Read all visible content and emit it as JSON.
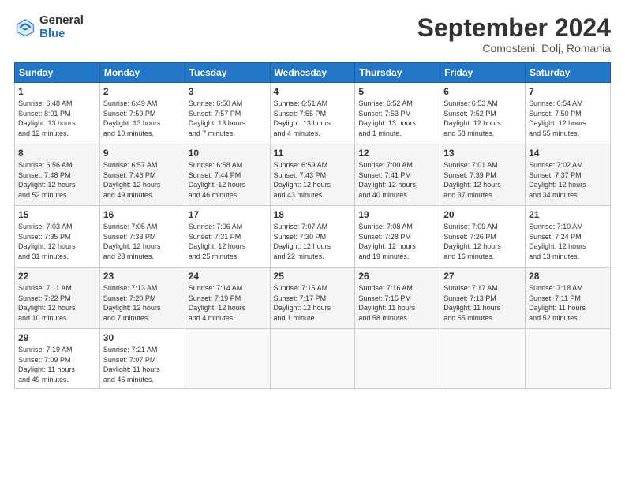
{
  "header": {
    "logo_general": "General",
    "logo_blue": "Blue",
    "month_title": "September 2024",
    "location": "Comosteni, Dolj, Romania"
  },
  "days_of_week": [
    "Sunday",
    "Monday",
    "Tuesday",
    "Wednesday",
    "Thursday",
    "Friday",
    "Saturday"
  ],
  "weeks": [
    [
      {
        "day": "1",
        "info": "Sunrise: 6:48 AM\nSunset: 8:01 PM\nDaylight: 13 hours\nand 12 minutes."
      },
      {
        "day": "2",
        "info": "Sunrise: 6:49 AM\nSunset: 7:59 PM\nDaylight: 13 hours\nand 10 minutes."
      },
      {
        "day": "3",
        "info": "Sunrise: 6:50 AM\nSunset: 7:57 PM\nDaylight: 13 hours\nand 7 minutes."
      },
      {
        "day": "4",
        "info": "Sunrise: 6:51 AM\nSunset: 7:55 PM\nDaylight: 13 hours\nand 4 minutes."
      },
      {
        "day": "5",
        "info": "Sunrise: 6:52 AM\nSunset: 7:53 PM\nDaylight: 13 hours\nand 1 minute."
      },
      {
        "day": "6",
        "info": "Sunrise: 6:53 AM\nSunset: 7:52 PM\nDaylight: 12 hours\nand 58 minutes."
      },
      {
        "day": "7",
        "info": "Sunrise: 6:54 AM\nSunset: 7:50 PM\nDaylight: 12 hours\nand 55 minutes."
      }
    ],
    [
      {
        "day": "8",
        "info": "Sunrise: 6:56 AM\nSunset: 7:48 PM\nDaylight: 12 hours\nand 52 minutes."
      },
      {
        "day": "9",
        "info": "Sunrise: 6:57 AM\nSunset: 7:46 PM\nDaylight: 12 hours\nand 49 minutes."
      },
      {
        "day": "10",
        "info": "Sunrise: 6:58 AM\nSunset: 7:44 PM\nDaylight: 12 hours\nand 46 minutes."
      },
      {
        "day": "11",
        "info": "Sunrise: 6:59 AM\nSunset: 7:43 PM\nDaylight: 12 hours\nand 43 minutes."
      },
      {
        "day": "12",
        "info": "Sunrise: 7:00 AM\nSunset: 7:41 PM\nDaylight: 12 hours\nand 40 minutes."
      },
      {
        "day": "13",
        "info": "Sunrise: 7:01 AM\nSunset: 7:39 PM\nDaylight: 12 hours\nand 37 minutes."
      },
      {
        "day": "14",
        "info": "Sunrise: 7:02 AM\nSunset: 7:37 PM\nDaylight: 12 hours\nand 34 minutes."
      }
    ],
    [
      {
        "day": "15",
        "info": "Sunrise: 7:03 AM\nSunset: 7:35 PM\nDaylight: 12 hours\nand 31 minutes."
      },
      {
        "day": "16",
        "info": "Sunrise: 7:05 AM\nSunset: 7:33 PM\nDaylight: 12 hours\nand 28 minutes."
      },
      {
        "day": "17",
        "info": "Sunrise: 7:06 AM\nSunset: 7:31 PM\nDaylight: 12 hours\nand 25 minutes."
      },
      {
        "day": "18",
        "info": "Sunrise: 7:07 AM\nSunset: 7:30 PM\nDaylight: 12 hours\nand 22 minutes."
      },
      {
        "day": "19",
        "info": "Sunrise: 7:08 AM\nSunset: 7:28 PM\nDaylight: 12 hours\nand 19 minutes."
      },
      {
        "day": "20",
        "info": "Sunrise: 7:09 AM\nSunset: 7:26 PM\nDaylight: 12 hours\nand 16 minutes."
      },
      {
        "day": "21",
        "info": "Sunrise: 7:10 AM\nSunset: 7:24 PM\nDaylight: 12 hours\nand 13 minutes."
      }
    ],
    [
      {
        "day": "22",
        "info": "Sunrise: 7:11 AM\nSunset: 7:22 PM\nDaylight: 12 hours\nand 10 minutes."
      },
      {
        "day": "23",
        "info": "Sunrise: 7:13 AM\nSunset: 7:20 PM\nDaylight: 12 hours\nand 7 minutes."
      },
      {
        "day": "24",
        "info": "Sunrise: 7:14 AM\nSunset: 7:19 PM\nDaylight: 12 hours\nand 4 minutes."
      },
      {
        "day": "25",
        "info": "Sunrise: 7:15 AM\nSunset: 7:17 PM\nDaylight: 12 hours\nand 1 minute."
      },
      {
        "day": "26",
        "info": "Sunrise: 7:16 AM\nSunset: 7:15 PM\nDaylight: 11 hours\nand 58 minutes."
      },
      {
        "day": "27",
        "info": "Sunrise: 7:17 AM\nSunset: 7:13 PM\nDaylight: 11 hours\nand 55 minutes."
      },
      {
        "day": "28",
        "info": "Sunrise: 7:18 AM\nSunset: 7:11 PM\nDaylight: 11 hours\nand 52 minutes."
      }
    ],
    [
      {
        "day": "29",
        "info": "Sunrise: 7:19 AM\nSunset: 7:09 PM\nDaylight: 11 hours\nand 49 minutes."
      },
      {
        "day": "30",
        "info": "Sunrise: 7:21 AM\nSunset: 7:07 PM\nDaylight: 11 hours\nand 46 minutes."
      },
      {
        "day": "",
        "info": ""
      },
      {
        "day": "",
        "info": ""
      },
      {
        "day": "",
        "info": ""
      },
      {
        "day": "",
        "info": ""
      },
      {
        "day": "",
        "info": ""
      }
    ]
  ]
}
